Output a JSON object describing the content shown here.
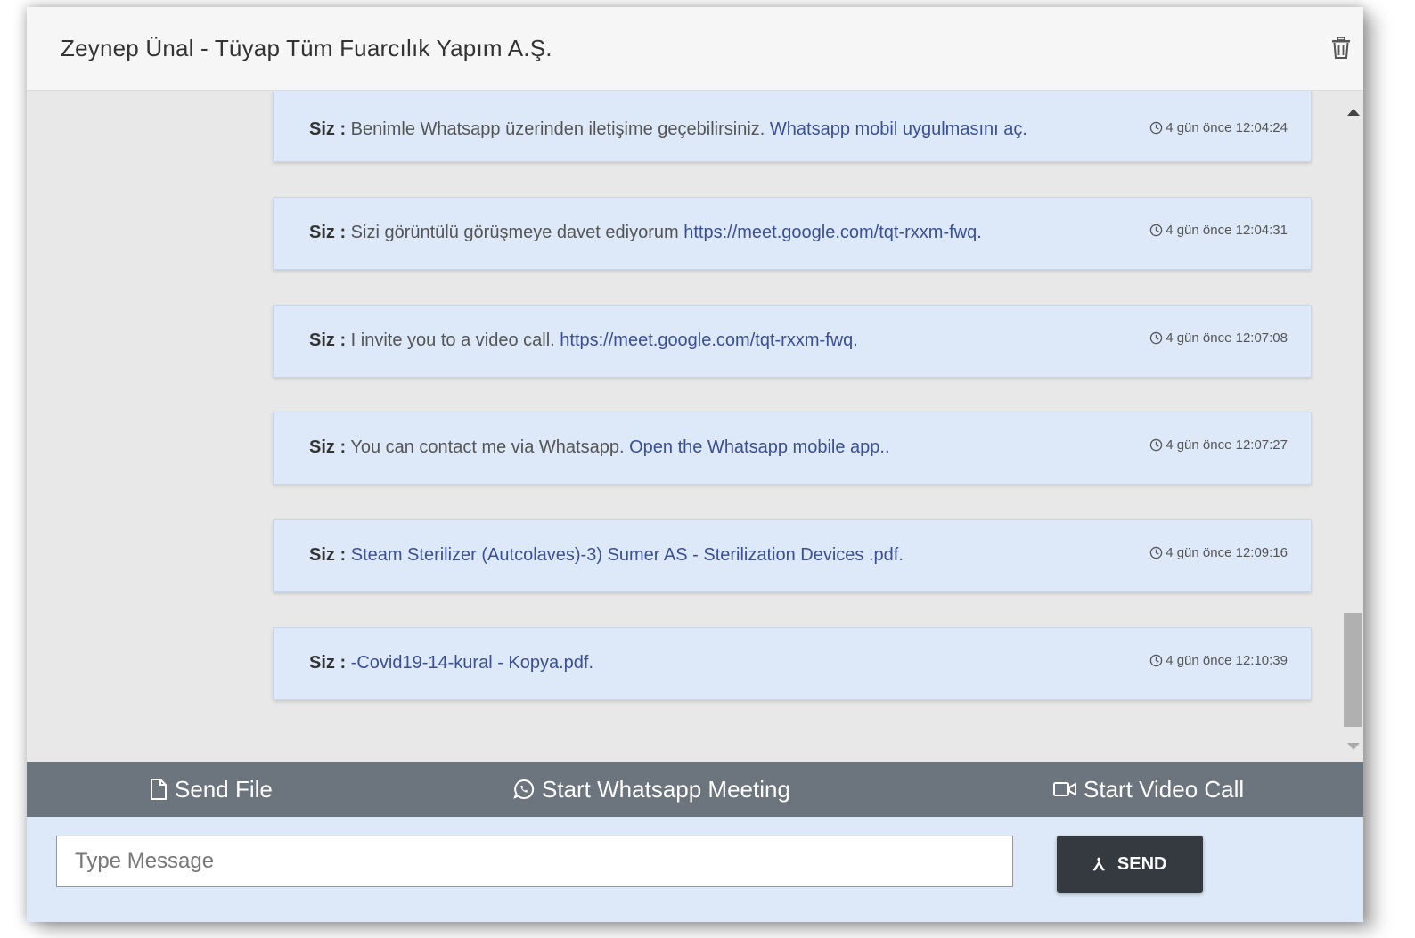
{
  "header": {
    "title": "Zeynep Ünal - Tüyap Tüm Fuarcılık Yapım A.Ş.",
    "delete_icon": "trash-icon"
  },
  "messages": [
    {
      "sender": "Siz :",
      "text": " Benimle Whatsapp üzerinden iletişime geçebilirsiniz. ",
      "link": "Whatsapp mobil uygulmasını aç.",
      "time": "4 gün önce 12:04:24"
    },
    {
      "sender": "Siz :",
      "text": " Sizi görüntülü görüşmeye davet ediyorum ",
      "link": "https://meet.google.com/tqt-rxxm-fwq.",
      "time": "4 gün önce 12:04:31"
    },
    {
      "sender": "Siz :",
      "text": " I invite you to a video call. ",
      "link": "https://meet.google.com/tqt-rxxm-fwq.",
      "time": "4 gün önce 12:07:08"
    },
    {
      "sender": "Siz :",
      "text": " You can contact me via Whatsapp. ",
      "link": "Open the Whatsapp mobile app..",
      "time": "4 gün önce 12:07:27"
    },
    {
      "sender": "Siz :",
      "text": " ",
      "link": "Steam Sterilizer (Autcolaves)-3) Sumer AS - Sterilization Devices .pdf.",
      "time": "4 gün önce 12:09:16"
    },
    {
      "sender": "Siz :",
      "text": " ",
      "link": "-Covid19-14-kural - Kopya.pdf.",
      "time": "4 gün önce 12:10:39"
    }
  ],
  "actions": {
    "send_file": "Send File",
    "whatsapp_meeting": "Start Whatsapp Meeting",
    "video_call": "Start Video Call"
  },
  "composer": {
    "placeholder": "Type Message",
    "value": "",
    "send_label": "SEND"
  },
  "colors": {
    "message_bg": "#dde9f8",
    "link": "#3a4f96",
    "action_bar": "#6c757d",
    "send_button": "#343a40"
  }
}
